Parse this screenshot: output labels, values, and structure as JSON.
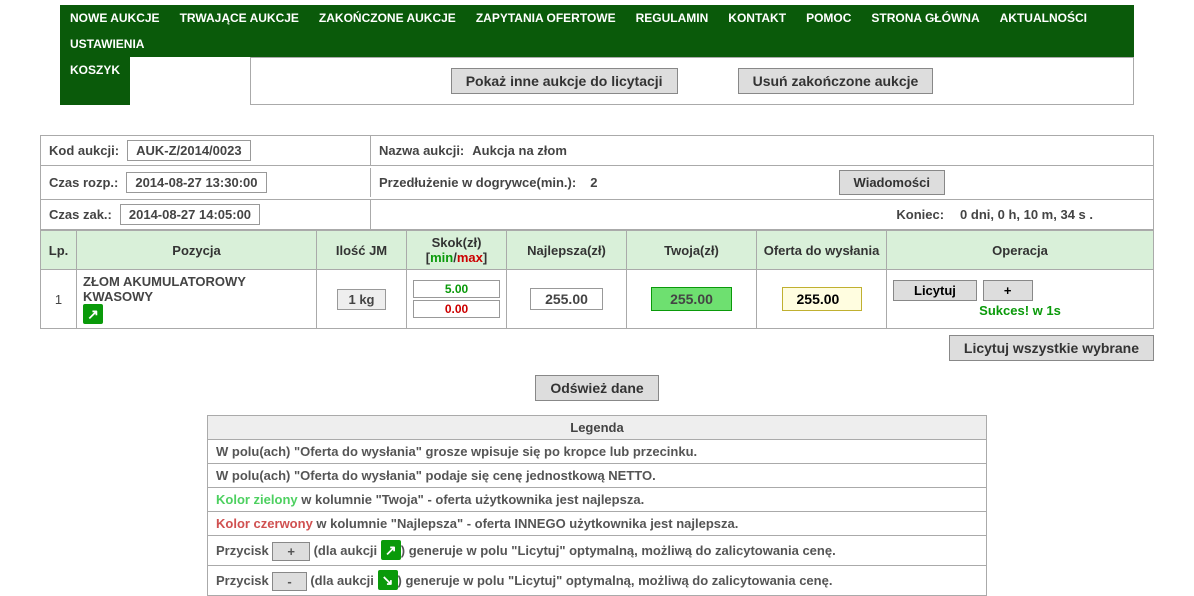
{
  "nav": [
    "NOWE AUKCJE",
    "TRWAJĄCE AUKCJE",
    "ZAKOŃCZONE AUKCJE",
    "ZAPYTANIA OFERTOWE",
    "REGULAMIN",
    "KONTAKT",
    "POMOC",
    "STRONA GŁÓWNA",
    "AKTUALNOŚCI",
    "USTAWIENIA"
  ],
  "nav2": [
    "KOSZYK"
  ],
  "topbar": {
    "show_other": "Pokaż inne aukcje do licytacji",
    "remove_finished": "Usuń zakończone aukcje"
  },
  "info": {
    "code_lbl": "Kod aukcji:",
    "code": "AUK-Z/2014/0023",
    "name_lbl": "Nazwa aukcji:",
    "name": "Aukcja na złom",
    "start_lbl": "Czas rozp.:",
    "start": "2014-08-27 13:30:00",
    "ext_lbl": "Przedłużenie w dogrywce(min.):",
    "ext": "2",
    "msgs": "Wiadomości",
    "end_lbl": "Czas zak.:",
    "end": "2014-08-27 14:05:00",
    "remain_lbl": "Koniec:",
    "remain": "0 dni, 0 h, 10 m, 34 s ."
  },
  "table": {
    "headers": {
      "lp": "Lp.",
      "pos": "Pozycja",
      "qty": "Ilość JM",
      "step": "Skok(zł)",
      "step_min": "min",
      "step_max": "max",
      "best": "Najlepsza(zł)",
      "yours": "Twoja(zł)",
      "offer": "Oferta do wysłania",
      "op": "Operacja"
    },
    "row": {
      "lp": "1",
      "pos": "ZŁOM AKUMULATOROWY KWASOWY",
      "qty": "1 kg",
      "skok_min": "5.00",
      "skok_max": "0.00",
      "best": "255.00",
      "yours": "255.00",
      "offer": "255.00",
      "bid": "Licytuj",
      "plus": "+",
      "success": "Sukces! w 1s"
    }
  },
  "buttons": {
    "bid_all": "Licytuj wszystkie wybrane",
    "refresh": "Odśwież dane"
  },
  "legend": {
    "title": "Legenda",
    "l1": "W polu(ach) \"Oferta do wysłania\" grosze wpisuje się po kropce lub przecinku.",
    "l2": "W polu(ach) \"Oferta do wysłania\" podaje się cenę jednostkową NETTO.",
    "l3a": "Kolor zielony",
    "l3b": " w kolumnie \"Twoja\" - oferta użytkownika jest najlepsza.",
    "l4a": "Kolor czerwony",
    "l4b": " w kolumnie \"Najlepsza\" - oferta INNEGO użytkownika jest najlepsza.",
    "l5a": "Przycisk ",
    "l5plus": "+",
    "l5b": " (dla aukcji ",
    "l5c": ") generuje w polu \"Licytuj\" optymalną, możliwą do zalicytowania cenę.",
    "l6a": "Przycisk ",
    "l6minus": "-",
    "l6b": " (dla aukcji ",
    "l6c": ") generuje w polu \"Licytuj\" optymalną, możliwą do zalicytowania cenę."
  },
  "icons": {
    "up": "↗",
    "down": "↘"
  }
}
